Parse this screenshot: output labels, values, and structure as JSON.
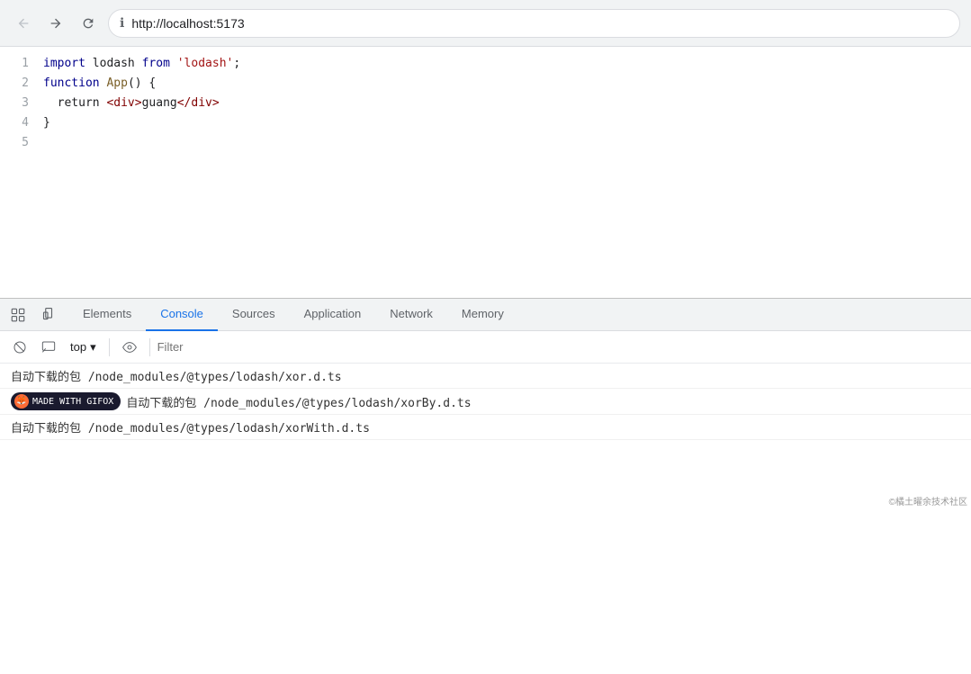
{
  "browser": {
    "url": "http://localhost:5173",
    "back_title": "Back",
    "forward_title": "Forward",
    "refresh_title": "Refresh"
  },
  "code": {
    "lines": [
      {
        "num": "1",
        "tokens": [
          {
            "type": "kw",
            "text": "import "
          },
          {
            "type": "id",
            "text": "lodash "
          },
          {
            "type": "kw",
            "text": "from "
          },
          {
            "type": "str",
            "text": "'lodash'"
          },
          {
            "type": "plain",
            "text": ";"
          }
        ]
      },
      {
        "num": "2",
        "tokens": [
          {
            "type": "kw",
            "text": "function "
          },
          {
            "type": "fn",
            "text": "App"
          },
          {
            "type": "plain",
            "text": "() {"
          }
        ]
      },
      {
        "num": "3",
        "tokens": [
          {
            "type": "plain",
            "text": "  return "
          },
          {
            "type": "tag",
            "text": "<div>"
          },
          {
            "type": "plain",
            "text": "guang"
          },
          {
            "type": "tag",
            "text": "</div>"
          }
        ]
      },
      {
        "num": "4",
        "tokens": [
          {
            "type": "plain",
            "text": "}"
          }
        ]
      },
      {
        "num": "5",
        "tokens": []
      }
    ]
  },
  "devtools": {
    "tabs": [
      {
        "id": "selector",
        "label": "",
        "icon": "selector"
      },
      {
        "id": "inspector",
        "label": "",
        "icon": "inspector"
      },
      {
        "id": "elements",
        "label": "Elements"
      },
      {
        "id": "console",
        "label": "Console",
        "active": true
      },
      {
        "id": "sources",
        "label": "Sources"
      },
      {
        "id": "application",
        "label": "Application"
      },
      {
        "id": "network",
        "label": "Network"
      },
      {
        "id": "memory",
        "label": "Memory"
      }
    ],
    "console": {
      "toolbar": {
        "clear_label": "Clear console",
        "top_label": "top",
        "dropdown_arrow": "▾",
        "eye_label": "Show live expressions",
        "filter_placeholder": "Filter"
      },
      "entries": [
        {
          "text": "自动下载的包 /node_modules/@types/lodash/xor.d.ts"
        },
        {
          "text": "自动下载的包 /node_modules/@types/lodash/xorBy.d.ts",
          "badge": true
        },
        {
          "text": "自动下载的包 /node_modules/@types/lodash/xorWith.d.ts"
        }
      ]
    }
  },
  "watermark": {
    "text": "©橘土曜余技术社区"
  },
  "gifox": {
    "label": "MADE WITH GIFOX"
  }
}
